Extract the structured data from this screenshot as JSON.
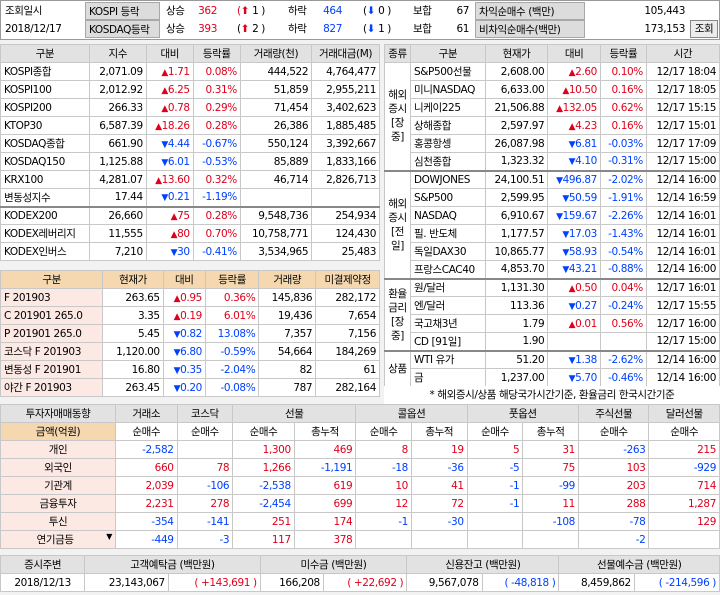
{
  "top": {
    "label_date": "조회일시",
    "date": "2018/12/17",
    "kospi_label": "KOSPI 등락",
    "kosdaq_label": "KOSDAQ등락",
    "up": "상승",
    "down": "하락",
    "flat": "보합",
    "kospi_up": "362",
    "kospi_upl": "1",
    "kospi_down": "464",
    "kospi_downl": "0",
    "kospi_flat": "67",
    "kosdaq_up": "393",
    "kosdaq_upl": "2",
    "kosdaq_down": "827",
    "kosdaq_downl": "1",
    "kosdaq_flat": "61",
    "arb_label": "차익순매수 (백만)",
    "arb_value": "105,443",
    "nonarb_label": "비차익순매수(백만)",
    "nonarb_value": "173,153",
    "query_button": "조회"
  },
  "index": {
    "headers": [
      "구분",
      "지수",
      "대비",
      "등락률",
      "거래량(천)",
      "거래대금(M)"
    ],
    "rows": [
      [
        "KOSPI종합",
        "2,071.09",
        "up",
        "1.71",
        "0.08%",
        "444,522",
        "4,764,477"
      ],
      [
        "KOSPI100",
        "2,012.92",
        "up",
        "6.25",
        "0.31%",
        "51,859",
        "2,955,211"
      ],
      [
        "KOSPI200",
        "266.33",
        "up",
        "0.78",
        "0.29%",
        "71,454",
        "3,402,623"
      ],
      [
        "KTOP30",
        "6,587.39",
        "up",
        "18.26",
        "0.28%",
        "26,386",
        "1,885,485"
      ],
      [
        "KOSDAQ종합",
        "661.90",
        "dn",
        "4.44",
        "-0.67%",
        "550,124",
        "3,392,667"
      ],
      [
        "KOSDAQ150",
        "1,125.88",
        "dn",
        "6.01",
        "-0.53%",
        "85,889",
        "1,833,166"
      ],
      [
        "KRX100",
        "4,281.07",
        "up",
        "13.60",
        "0.32%",
        "46,714",
        "2,826,713"
      ],
      [
        "변동성지수",
        "17.44",
        "dn",
        "0.21",
        "-1.19%",
        "",
        ""
      ],
      [
        "KODEX200",
        "26,660",
        "up",
        "75",
        "0.28%",
        "9,548,736",
        "254,934"
      ],
      [
        "KODEX레버리지",
        "11,555",
        "up",
        "80",
        "0.70%",
        "10,758,771",
        "124,430"
      ],
      [
        "KODEX인버스",
        "7,210",
        "dn",
        "30",
        "-0.41%",
        "3,534,965",
        "25,483"
      ]
    ]
  },
  "deriv": {
    "headers": [
      "구분",
      "현재가",
      "대비",
      "등락률",
      "거래량",
      "미결제약정"
    ],
    "rows": [
      [
        "F 201903",
        "263.65",
        "up",
        "0.95",
        "0.36%",
        "145,836",
        "282,172"
      ],
      [
        "C 201901 265.0",
        "3.35",
        "up",
        "0.19",
        "6.01%",
        "19,436",
        "7,654"
      ],
      [
        "P 201901 265.0",
        "5.45",
        "dn",
        "0.82",
        "13.08%",
        "7,357",
        "7,156"
      ],
      [
        "코스닥 F 201903",
        "1,120.00",
        "dn",
        "6.80",
        "-0.59%",
        "54,664",
        "184,269"
      ],
      [
        "변동성 F 201901",
        "16.80",
        "dn",
        "0.35",
        "-2.04%",
        "82",
        "61"
      ],
      [
        "야간 F 201903",
        "263.45",
        "dn",
        "0.20",
        "-0.08%",
        "787",
        "282,164"
      ]
    ]
  },
  "world": {
    "headers": [
      "종류",
      "구분",
      "현재가",
      "대비",
      "등락률",
      "시간"
    ],
    "groups": [
      {
        "label": [
          "해외",
          "증시",
          "[장중]"
        ],
        "rows": [
          [
            "S&P500선물",
            "2,608.00",
            "up",
            "2.60",
            "0.10%",
            "12/17 18:04"
          ],
          [
            "미니NASDAQ",
            "6,633.00",
            "up",
            "10.50",
            "0.16%",
            "12/17 18:05"
          ],
          [
            "니케이225",
            "21,506.88",
            "up",
            "132.05",
            "0.62%",
            "12/17 15:15"
          ],
          [
            "상해종합",
            "2,597.97",
            "up",
            "4.23",
            "0.16%",
            "12/17 15:01"
          ],
          [
            "홍콩항셍",
            "26,087.98",
            "dn",
            "6.81",
            "-0.03%",
            "12/17 17:09"
          ],
          [
            "심천종합",
            "1,323.32",
            "dn",
            "4.10",
            "-0.31%",
            "12/17 15:00"
          ]
        ]
      },
      {
        "label": [
          "해외",
          "증시",
          "[전일]"
        ],
        "rows": [
          [
            "DOWJONES",
            "24,100.51",
            "dn",
            "496.87",
            "-2.02%",
            "12/14 16:00"
          ],
          [
            "S&P500",
            "2,599.95",
            "dn",
            "50.59",
            "-1.91%",
            "12/14 16:59"
          ],
          [
            "NASDAQ",
            "6,910.67",
            "dn",
            "159.67",
            "-2.26%",
            "12/14 16:01"
          ],
          [
            "필. 반도체",
            "1,177.57",
            "dn",
            "17.03",
            "-1.43%",
            "12/14 16:01"
          ],
          [
            "독일DAX30",
            "10,865.77",
            "dn",
            "58.93",
            "-0.54%",
            "12/14 16:01"
          ],
          [
            "프랑스CAC40",
            "4,853.70",
            "dn",
            "43.21",
            "-0.88%",
            "12/14 16:00"
          ]
        ]
      },
      {
        "label": [
          "환율",
          "금리",
          "[장중]"
        ],
        "rows": [
          [
            "원/달러",
            "1,131.30",
            "up",
            "0.50",
            "0.04%",
            "12/17 16:01"
          ],
          [
            "엔/달러",
            "113.36",
            "dn",
            "0.27",
            "-0.24%",
            "12/17 15:55"
          ],
          [
            "국고채3년",
            "1.79",
            "up",
            "0.01",
            "0.56%",
            "12/17 16:00"
          ],
          [
            "CD [91일]",
            "1.90",
            "",
            "",
            "",
            "12/17 15:00"
          ]
        ]
      },
      {
        "label": [
          "상품"
        ],
        "rows": [
          [
            "WTI 유가",
            "51.20",
            "dn",
            "1.38",
            "-2.62%",
            "12/14 16:00"
          ],
          [
            "금",
            "1,237.00",
            "dn",
            "5.70",
            "-0.46%",
            "12/14 16:00"
          ]
        ]
      }
    ],
    "note": "* 해외증시/상품 해당국가시간기준, 환율금리 한국시간기준"
  },
  "investors": {
    "title": "투자자매매동향",
    "groups": [
      "거래소",
      "코스닥",
      "선물",
      "콜옵션",
      "풋옵션",
      "주식선물",
      "달러선물"
    ],
    "amount_label": "금액(억원)",
    "subheaders": [
      "순매수",
      "순매수",
      "순매수",
      "총누적",
      "순매수",
      "총누적",
      "순매수",
      "총누적",
      "순매수",
      "순매수"
    ],
    "rows": [
      [
        "개인",
        "-2,582",
        "",
        "1,300",
        "469",
        "8",
        "19",
        "5",
        "31",
        "-263",
        "215"
      ],
      [
        "외국인",
        "660",
        "78",
        "1,266",
        "-1,191",
        "-18",
        "-36",
        "-5",
        "75",
        "103",
        "-929"
      ],
      [
        "기관계",
        "2,039",
        "-106",
        "-2,538",
        "619",
        "10",
        "41",
        "-1",
        "-99",
        "203",
        "714"
      ],
      [
        "금융투자",
        "2,231",
        "278",
        "-2,454",
        "699",
        "12",
        "72",
        "-1",
        "11",
        "288",
        "1,287"
      ],
      [
        "투신",
        "-354",
        "-141",
        "251",
        "174",
        "-1",
        "-30",
        "",
        "-108",
        "-78",
        "129"
      ],
      [
        "연기금등",
        "-449",
        "-3",
        "117",
        "378",
        "",
        "",
        "",
        "",
        "-2",
        ""
      ]
    ]
  },
  "bottom": {
    "headers": [
      "증시주변",
      "고객예탁금 (백만원)",
      "미수금 (백만원)",
      "신용잔고 (백만원)",
      "선물예수금 (백만원)"
    ],
    "date": "2018/12/13",
    "deposit": "23,143,067",
    "deposit_chg": "( +143,691 )",
    "unpaid": "166,208",
    "unpaid_chg": "( +22,692 )",
    "credit": "9,567,078",
    "credit_chg": "( -48,818 )",
    "futures": "8,459,862",
    "futures_chg": "( -214,596 )"
  }
}
